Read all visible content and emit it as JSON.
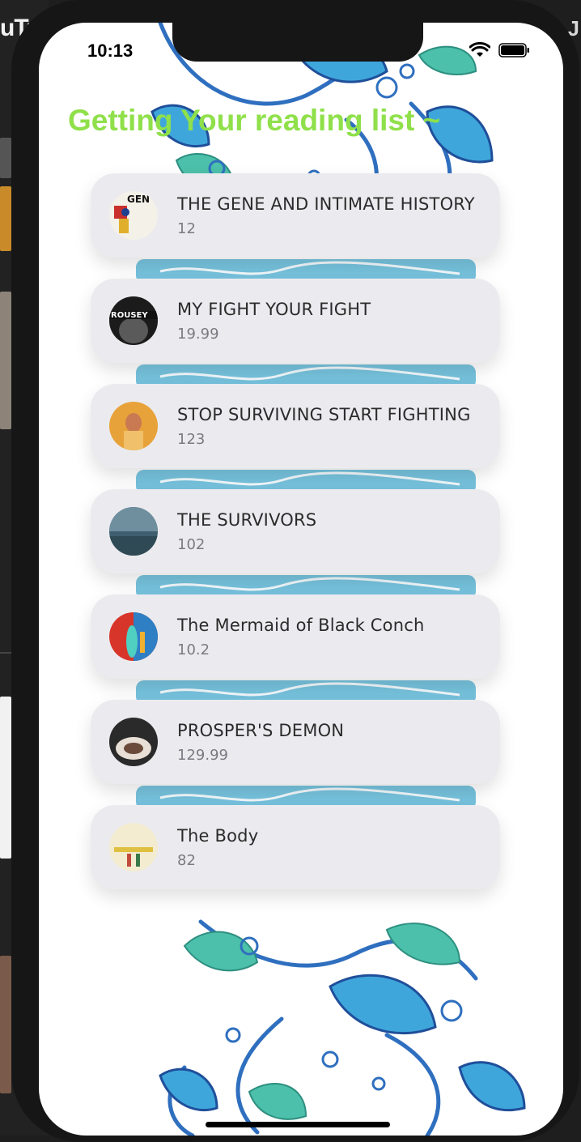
{
  "background_app": {
    "logo_fragment": "uTu",
    "right_fragment": "J"
  },
  "status_bar": {
    "time": "10:13"
  },
  "header": {
    "title": "Getting Your reading list ~"
  },
  "books": [
    {
      "title": "THE GENE AND INTIMATE HISTORY",
      "price": "12"
    },
    {
      "title": "MY FIGHT YOUR FIGHT",
      "price": "19.99"
    },
    {
      "title": "STOP SURVIVING START FIGHTING",
      "price": "123"
    },
    {
      "title": "THE SURVIVORS",
      "price": "102"
    },
    {
      "title": "The Mermaid of Black Conch",
      "price": "10.2"
    },
    {
      "title": "PROSPER'S DEMON",
      "price": "129.99"
    },
    {
      "title": "The Body",
      "price": "82"
    }
  ],
  "colors": {
    "title": "#8fe04a",
    "card": "#ebebef",
    "floral_blue": "#3f8fd6",
    "floral_teal": "#3fb8a6"
  }
}
